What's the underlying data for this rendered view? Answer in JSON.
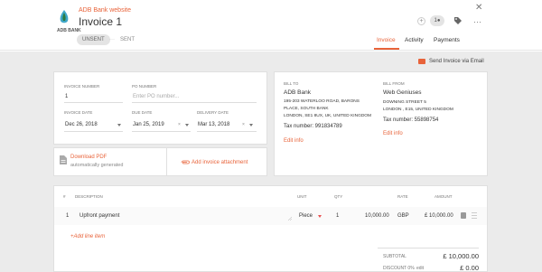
{
  "header": {
    "subtitle": "ADB Bank website",
    "title": "Invoice 1",
    "logo_text": "ADB BANK",
    "status_unsent": "UNSENT",
    "status_sep": "···",
    "status_sent": "SENT",
    "user_count": "1",
    "plus": "+",
    "more": "···",
    "close": "✕"
  },
  "tabs": [
    {
      "label": "Invoice"
    },
    {
      "label": "Activity"
    },
    {
      "label": "Payments"
    }
  ],
  "send_link": "Send Invoice via Email",
  "invoice_meta": {
    "invoice_number_label": "INVOICE NUMBER",
    "invoice_number": "1",
    "po_label": "PO NUMBER",
    "po_placeholder": "Enter PO number...",
    "invoice_date_label": "INVOICE DATE",
    "invoice_date": "Dec 26, 2018",
    "due_date_label": "DUE DATE",
    "due_date": "Jan 25, 2019",
    "delivery_date_label": "DELIVERY DATE",
    "delivery_date": "Mar 13, 2018",
    "clear": "×"
  },
  "attachments": {
    "download_pdf": "Download PDF",
    "download_sub": "automatically generated",
    "add_attachment": "Add invoice attachment"
  },
  "bill_to": {
    "label": "BILL TO",
    "name": "ADB Bank",
    "address1": "195-203 WATERLOO ROAD, BARONS",
    "address2": "PLACE, SOUTH BANK",
    "address3": "LONDON, SE1 8UX, UK, UNITED KINGDOM",
    "tax": "Tax number: 991834789",
    "edit": "Edit info"
  },
  "bill_from": {
    "label": "BILL FROM",
    "name": "Web Geniuses",
    "address1": "DOWNING STREET 5",
    "address2": "LONDON , E15, UNITED KINGDOM",
    "tax": "Tax number: 55898754",
    "edit": "Edit info"
  },
  "table": {
    "headers": {
      "num": "#",
      "description": "DESCRIPTION",
      "unit": "UNIT",
      "qty": "QTY",
      "rate": "RATE",
      "amount": "AMOUNT"
    },
    "rows": [
      {
        "num": "1",
        "description": "Upfront payment",
        "unit": "Piece",
        "qty": "1",
        "rate": "10,000.00",
        "currency": "GBP",
        "amount": "£ 10,000.00"
      }
    ],
    "add_line": "+Add line item"
  },
  "summary": {
    "subtotal_label": "SUBTOTAL",
    "subtotal_value": "£ 10,000.00",
    "discount_label": "DISCOUNT 0%",
    "discount_edit": "edit",
    "discount_value": "£ 0.00"
  },
  "colors": {
    "accent": "#e8633a",
    "background": "#ebebeb"
  }
}
